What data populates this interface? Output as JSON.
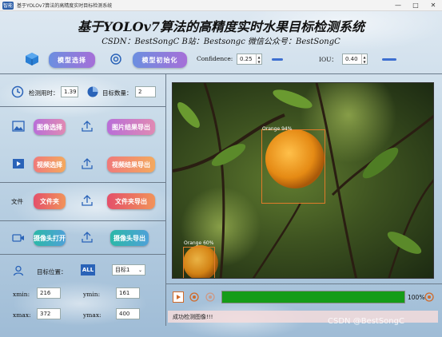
{
  "window": {
    "icon_text": "智能",
    "title": "基于YOLOv7算法的高精度实时目标检测系统",
    "controls": [
      "—",
      "□",
      "✕"
    ]
  },
  "header": {
    "title": "基于YOLOv7算法的高精度实时水果目标检测系统",
    "subtitle": "CSDN：BestSongC   B站：Bestsongc   微信公众号：BestSongC"
  },
  "toolbar": {
    "model_select_label": "模型选择",
    "model_init_label": "模型初始化",
    "confidence_label": "Confidence:",
    "confidence_value": "0.25",
    "iou_label": "IOU：",
    "iou_value": "0.40"
  },
  "stats": {
    "time_label": "检测用时：",
    "time_value": "1.39",
    "count_label": "目标数量：",
    "count_value": "2"
  },
  "actions": {
    "image_select": "图像选择",
    "image_export": "图片结果导出",
    "video_select": "视频选择",
    "video_export": "视频结果导出",
    "folder_label": "文件",
    "folder_open": "文件夹",
    "folder_export": "文件夹导出",
    "camera_open": "摄像头打开",
    "camera_export": "摄像头导出"
  },
  "location": {
    "label": "目标位置：",
    "all_label": "ALL",
    "target_select": "目标1",
    "xmin_label": "xmin:",
    "xmin_value": "216",
    "ymin_label": "ymin:",
    "ymin_value": "161",
    "xmax_label": "xmax:",
    "xmax_value": "372",
    "ymax_label": "ymax:",
    "ymax_value": "400"
  },
  "detections": [
    {
      "label": "Orange 94%"
    },
    {
      "label": "Orange 60%"
    }
  ],
  "progress": {
    "percent_label": "100%",
    "fraction": 1.0
  },
  "status": {
    "message": "成功检测图像!!!"
  },
  "watermark": "CSDN @BestSongC",
  "colors": {
    "progress_fill": "#159c18",
    "box": "#e07b2a",
    "accent": "#3d6fd0"
  }
}
